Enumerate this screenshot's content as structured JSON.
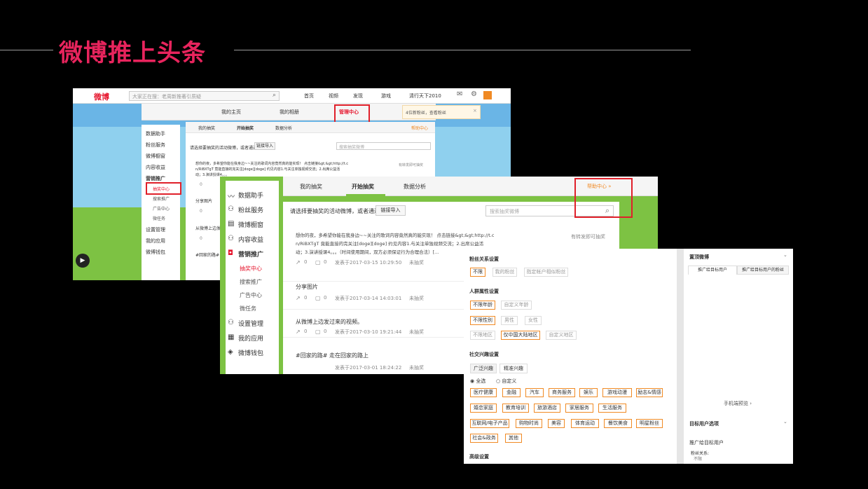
{
  "slide": {
    "title": "微博推上头条"
  },
  "s1": {
    "logo": "微博",
    "search_placeholder": "大家正在搜：老周新推著引质疑",
    "topnav": [
      "首页",
      "视频",
      "发现",
      "游戏",
      "清行天下2010"
    ],
    "tabs": [
      "我的主页",
      "我的相册",
      "管理中心"
    ],
    "notice": "4位新粉丝，查看粉丝",
    "sidebar": [
      "数据助手",
      "粉丝服务",
      "微博橱窗",
      "内容收益",
      "营销推广",
      "抽奖中心",
      "搜索推广",
      "广告中心",
      "微任务",
      "设置管理",
      "我的应用",
      "微博钱包"
    ],
    "subtabs": [
      "我的抽奖",
      "开始抽奖",
      "数据分析"
    ],
    "help": "帮助中心",
    "hint": "请选择要抽奖的活动微博，或者通过",
    "link_btn": "链接导入",
    "search2": "搜索抽奖微博",
    "post1_l1": "想你的夜，多希望你能在我身边~~关注的歌词内容竟然真的能实现！ 点击链接&gt;&gt;http://t.c",
    "post1_l2": "n/RiBXTgT 竟能直接的完关注[doge][doge] 约见内容1.与关注单独视频交流；2.出席公益活",
    "post1_l3": "动；3.演讲授课4。。。",
    "post1_right": "有转发即可抽奖",
    "p2": "分享图片",
    "p3": "从微博上边发过来的视频。",
    "p4": "#回家的路# 走在回家的路上",
    "zero": "0"
  },
  "s2": {
    "sidebar": [
      "数据助手",
      "粉丝服务",
      "微博橱窗",
      "内容收益",
      "营销推广",
      "抽奖中心",
      "搜索推广",
      "广告中心",
      "微任务",
      "设置管理",
      "我的应用",
      "微博钱包"
    ],
    "subtabs": [
      "我的抽奖",
      "开始抽奖",
      "数据分析"
    ],
    "help": "帮助中心 »",
    "hint": "请选择要抽奖的活动微博，或者通过",
    "link_btn": "链接导入",
    "search": "搜索抽奖微博",
    "post1_l1": "想你的夜，多希望你能在我身边~~关注的歌词内容竟然真的能实现！ 点击链接&gt;&gt;http://t.c",
    "post1_l2": "n/RiBXTgT 竟能直接的完关注[doge][doge] 约见内容1.与关注单独视频交流；2.出席公益活",
    "post1_l3": "动；3.演讲授课4。。。（时间使用期间，双方必须保证行为合理合法）[...",
    "post1_right": "有转发即可抽奖",
    "zero": "0",
    "posts": [
      {
        "meta": "发表于2017-03-15 10:29:50",
        "status": "未抽奖"
      },
      {
        "text": "分享图片",
        "meta": "发表于2017-03-14 14:03:01",
        "status": "未抽奖"
      },
      {
        "text": "从微博上边发过来的视频。",
        "meta": "发表于2017-03-10 19:21:44",
        "status": "未抽奖"
      },
      {
        "text": "#回家的路# 走在回家的路上",
        "meta": "发表于2017-03-01 18:24:22",
        "status": "未抽奖"
      }
    ]
  },
  "s3": {
    "sec_fans": "粉丝关系设置",
    "fans_opts": [
      "不限",
      "我的粉丝",
      "指定帐户相似粉丝"
    ],
    "sec_people": "人群属性设置",
    "age_opts": [
      "不限年龄",
      "自定义年龄"
    ],
    "gender_opts": [
      "不限性别",
      "男性",
      "女性"
    ],
    "area_opts": [
      "不限地区",
      "仅中国大陆地区",
      "自定义地区"
    ],
    "sec_interest": "社交兴趣设置",
    "interest_tabs": [
      "广泛兴趣",
      "精准兴趣"
    ],
    "radio_all": "全选",
    "radio_custom": "自定义",
    "tags_r1": [
      "医疗健康",
      "金融",
      "汽车",
      "商务服务",
      "娱乐",
      "游戏动漫",
      "励志&情感"
    ],
    "tags_r2": [
      "婚恋家庭",
      "教育培训",
      "旅游酒店",
      "家居服务",
      "生活服务"
    ],
    "tags_r3": [
      "互联网/电子产品",
      "购物时尚",
      "美容",
      "体育运动",
      "餐饮美食",
      "明星粉丝"
    ],
    "tags_r4": [
      "社会&政务",
      "其他"
    ],
    "sec_adv": "高级设置",
    "panel_title": "置顶微博",
    "panel_tabs": [
      "推广给目标用户",
      "推广给目标用户的粉丝"
    ],
    "preview": "手机端预览 ›",
    "target_title": "目标用户选项",
    "target_text": "推广给目标用户",
    "fans_rel": "粉丝关系:",
    "fans_val": "不限"
  },
  "colors": {
    "accent": "#e8245d",
    "orange": "#f08a24",
    "red": "#e0202a",
    "grass": "#7dc243"
  }
}
